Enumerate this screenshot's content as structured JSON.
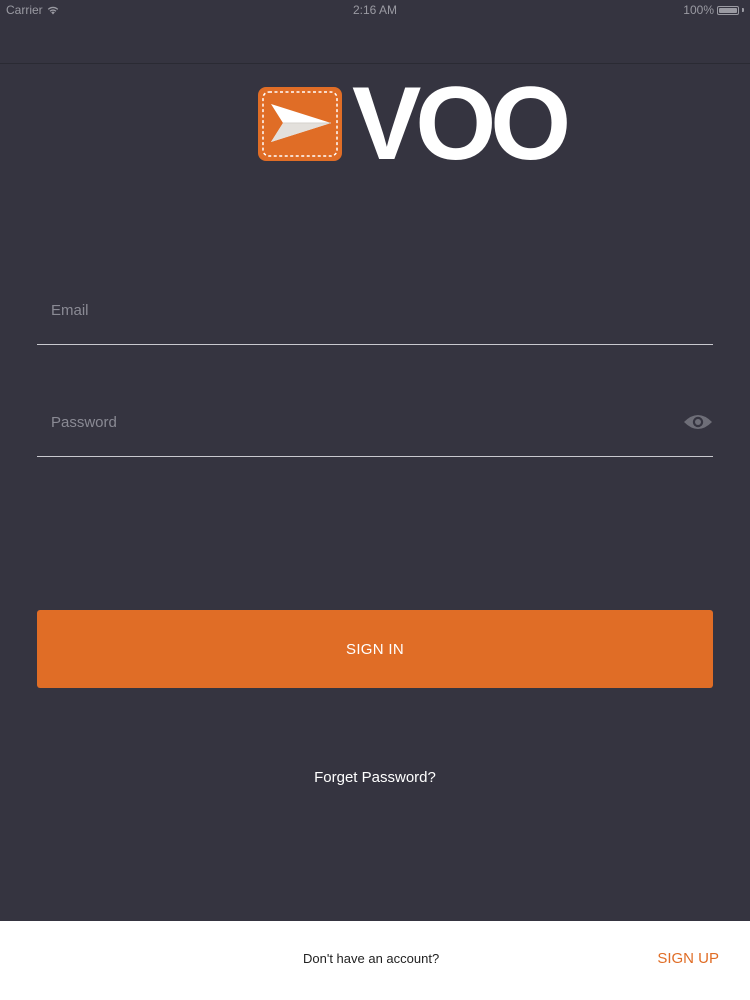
{
  "status_bar": {
    "carrier": "Carrier",
    "time": "2:16 AM",
    "battery": "100%"
  },
  "logo": {
    "text": "VOO",
    "icon": "paper-plane-icon",
    "badge_color": "#e06d26"
  },
  "form": {
    "email_placeholder": "Email",
    "email_value": "",
    "password_placeholder": "Password",
    "password_value": "",
    "password_toggle_icon": "eye-icon"
  },
  "actions": {
    "signin_label": "SIGN IN",
    "forgot_label": "Forget Password?"
  },
  "footer": {
    "prompt": "Don't have an account?",
    "signup_label": "SIGN UP"
  },
  "colors": {
    "background": "#353440",
    "accent": "#e06d26",
    "footer_background": "#ffffff"
  }
}
